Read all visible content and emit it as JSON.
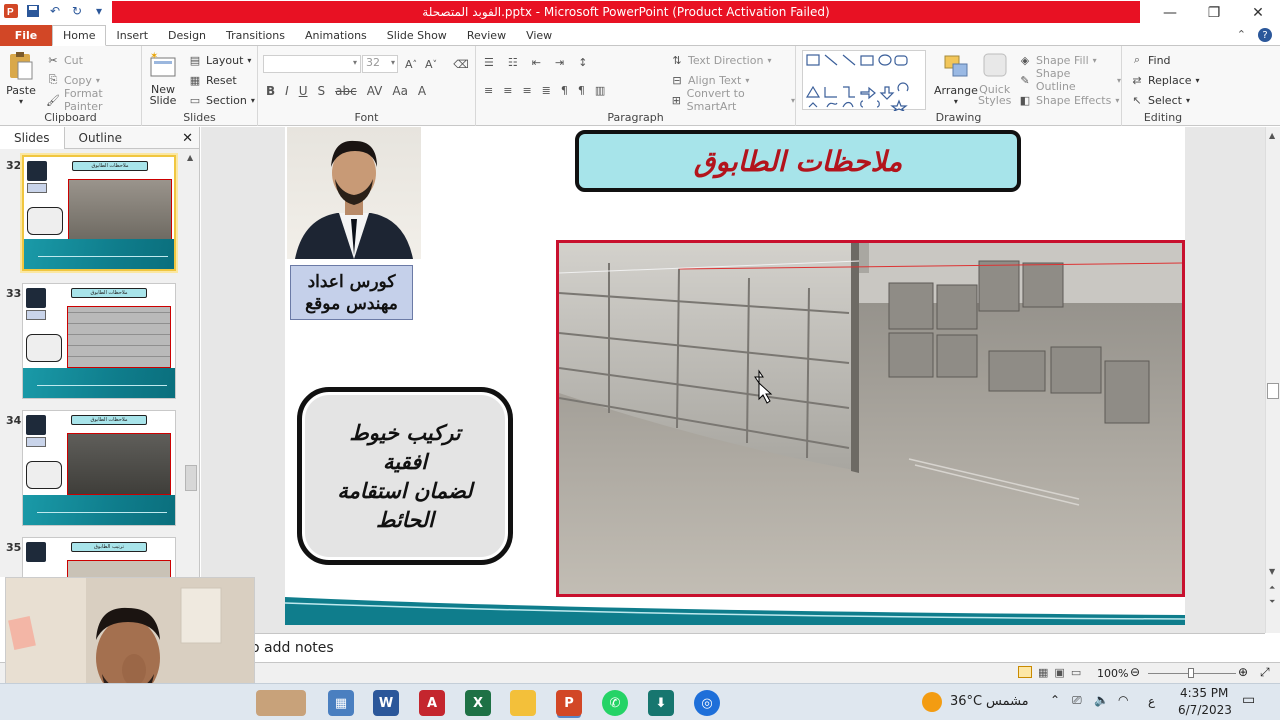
{
  "window": {
    "title": "الفوبد المتصحلة.pptx - Microsoft PowerPoint (Product Activation Failed)"
  },
  "tabs": [
    "File",
    "Home",
    "Insert",
    "Design",
    "Transitions",
    "Animations",
    "Slide Show",
    "Review",
    "View"
  ],
  "ribbon": {
    "clipboard": {
      "paste": "Paste",
      "cut": "Cut",
      "copy": "Copy",
      "format_painter": "Format Painter",
      "label": "Clipboard"
    },
    "slides": {
      "new_slide_1": "New",
      "new_slide_2": "Slide",
      "layout": "Layout",
      "reset": "Reset",
      "section": "Section",
      "label": "Slides"
    },
    "font": {
      "size": "32",
      "label": "Font"
    },
    "paragraph": {
      "text_direction": "Text Direction",
      "align_text": "Align Text",
      "convert_smartart": "Convert to SmartArt",
      "label": "Paragraph"
    },
    "drawing": {
      "arrange": "Arrange",
      "quick_styles_1": "Quick",
      "quick_styles_2": "Styles",
      "shape_fill": "Shape Fill",
      "shape_outline": "Shape Outline",
      "shape_effects": "Shape Effects",
      "label": "Drawing"
    },
    "editing": {
      "find": "Find",
      "replace": "Replace",
      "select": "Select",
      "label": "Editing"
    }
  },
  "panel": {
    "tabs": [
      "Slides",
      "Outline"
    ],
    "thumbs": [
      {
        "num": "32",
        "title": "ملاحظات الطابوق"
      },
      {
        "num": "33",
        "title": "ملاحظات الطابوق"
      },
      {
        "num": "34",
        "title": "ملاحظات الطابوق"
      },
      {
        "num": "35",
        "title": "ترتيب الطابوق"
      }
    ]
  },
  "slide": {
    "title": "ملاحظات الطابوق",
    "course_line1": "كورس اعداد",
    "course_line2": "مهندس موقع",
    "note_line1": "تركيب خيوط",
    "note_line2": "افقية",
    "note_line3": "لضمان استقامة",
    "note_line4": "الحائط"
  },
  "notes": {
    "placeholder": "o add notes"
  },
  "status": {
    "zoom": "100%"
  },
  "taskbar": {
    "weather_temp": "36°C",
    "weather_text": "مشمس",
    "lang": "ع",
    "time": "4:35 PM",
    "date": "6/7/2023"
  },
  "colors": {
    "file_tab": "#d24726",
    "title_error": "#e81123",
    "slide_title_text": "#b3141c",
    "slide_title_fill": "#a7e4ea",
    "photo_border": "#c8102e"
  }
}
